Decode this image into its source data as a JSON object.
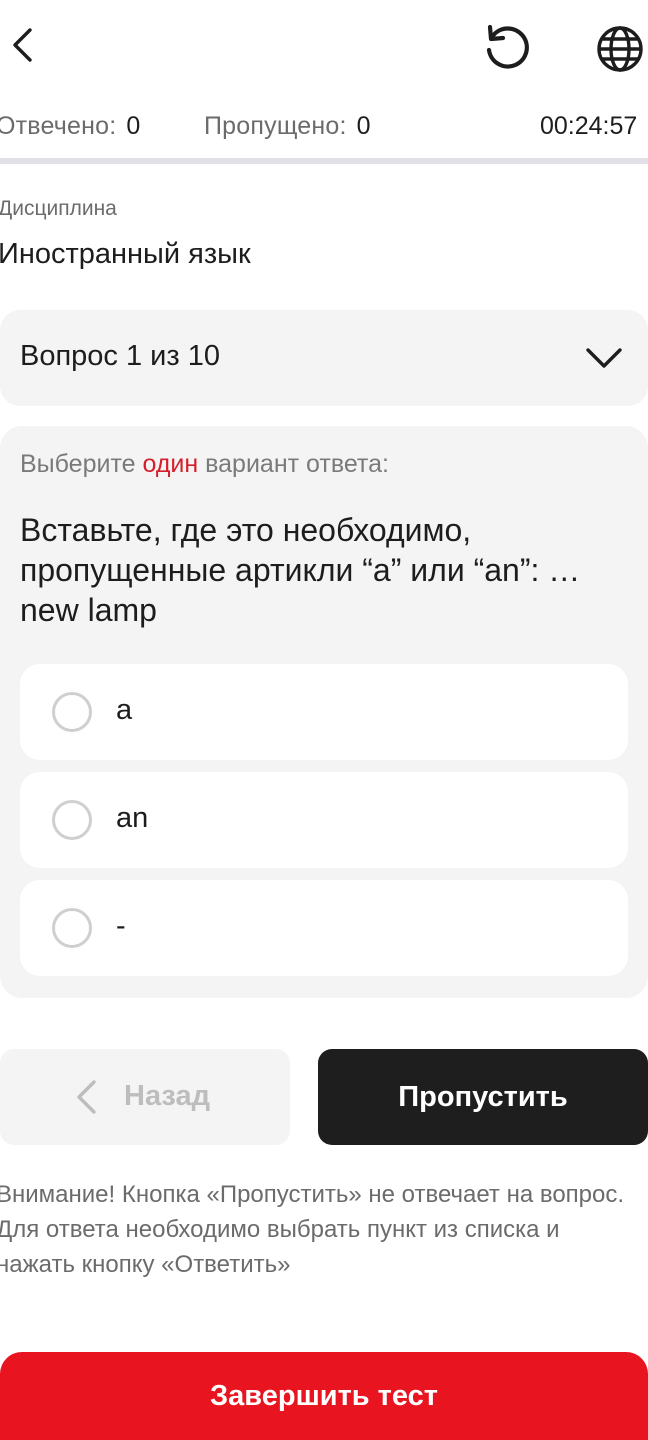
{
  "header": {
    "back_icon": "chevron-left-icon",
    "reset_icon": "restart-icon",
    "language_icon": "globe-icon"
  },
  "stats": {
    "answered_label": "Отвечено:",
    "answered_value": "0",
    "skipped_label": "Пропущено:",
    "skipped_value": "0",
    "timer": "00:24:57"
  },
  "discipline": {
    "label": "Дисциплина",
    "value": "Иностранный язык"
  },
  "question_selector": {
    "label": "Вопрос 1 из 10",
    "icon": "chevron-down-icon"
  },
  "question": {
    "instruction_prefix": "Выберите ",
    "instruction_accent": "один",
    "instruction_suffix": " вариант ответа:",
    "text": "Вставьте, где это необходимо, пропущенные артикли “a” или “an”: … new lamp",
    "options": [
      {
        "label": "a"
      },
      {
        "label": "an"
      },
      {
        "label": "-"
      }
    ]
  },
  "navigation": {
    "back_label": "Назад",
    "skip_label": "Пропустить"
  },
  "warning": "Внимание! Кнопка «Пропустить» не отвечает на вопрос. Для ответа необходимо выбрать пункт из списка и нажать кнопку «Ответить»",
  "finish_label": "Завершить тест",
  "colors": {
    "accent_red": "#e8141f",
    "dark_button": "#1e1e1e",
    "card_bg": "#f4f4f4"
  }
}
